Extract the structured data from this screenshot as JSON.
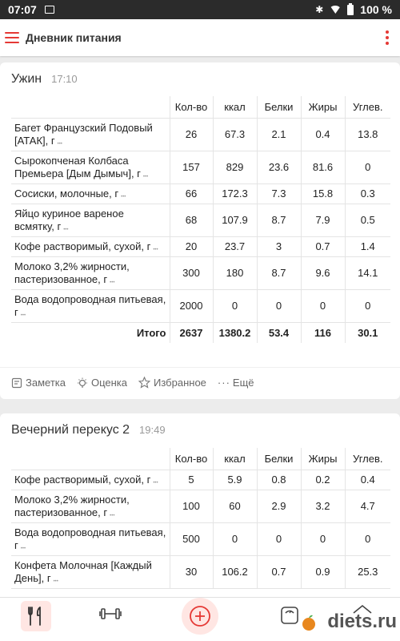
{
  "status": {
    "time": "07:07",
    "battery": "100 %"
  },
  "appbar": {
    "title": "Дневник питания"
  },
  "columns": [
    "Кол-во",
    "ккал",
    "Белки",
    "Жиры",
    "Углев."
  ],
  "meal1": {
    "name": "Ужин",
    "time": "17:10",
    "rows": [
      {
        "name": "Багет Французский Подовый [АТАК], г",
        "qty": "26",
        "kcal": "67.3",
        "protein": "2.1",
        "fat": "0.4",
        "carbs": "13.8"
      },
      {
        "name": "Сырокопченая Колбаса Премьера [Дым Дымыч], г",
        "qty": "157",
        "kcal": "829",
        "protein": "23.6",
        "fat": "81.6",
        "carbs": "0"
      },
      {
        "name": "Сосиски, молочные, г",
        "qty": "66",
        "kcal": "172.3",
        "protein": "7.3",
        "fat": "15.8",
        "carbs": "0.3"
      },
      {
        "name": "Яйцо куриное вареное всмятку, г",
        "qty": "68",
        "kcal": "107.9",
        "protein": "8.7",
        "fat": "7.9",
        "carbs": "0.5"
      },
      {
        "name": "Кофе растворимый, сухой, г",
        "qty": "20",
        "kcal": "23.7",
        "protein": "3",
        "fat": "0.7",
        "carbs": "1.4"
      },
      {
        "name": "Молоко 3,2% жирности, пастеризованное, г",
        "qty": "300",
        "kcal": "180",
        "protein": "8.7",
        "fat": "9.6",
        "carbs": "14.1"
      },
      {
        "name": "Вода водопроводная питьевая, г",
        "qty": "2000",
        "kcal": "0",
        "protein": "0",
        "fat": "0",
        "carbs": "0"
      }
    ],
    "total": {
      "label": "Итого",
      "qty": "2637",
      "kcal": "1380.2",
      "protein": "53.4",
      "fat": "116",
      "carbs": "30.1"
    },
    "actions": {
      "note": "Заметка",
      "rating": "Оценка",
      "favorite": "Избранное",
      "more": "Ещё"
    }
  },
  "meal2": {
    "name": "Вечерний перекус 2",
    "time": "19:49",
    "rows": [
      {
        "name": "Кофе растворимый, сухой, г",
        "qty": "5",
        "kcal": "5.9",
        "protein": "0.8",
        "fat": "0.2",
        "carbs": "0.4"
      },
      {
        "name": "Молоко 3,2% жирности, пастеризованное, г",
        "qty": "100",
        "kcal": "60",
        "protein": "2.9",
        "fat": "3.2",
        "carbs": "4.7"
      },
      {
        "name": "Вода водопроводная питьевая, г",
        "qty": "500",
        "kcal": "0",
        "protein": "0",
        "fat": "0",
        "carbs": "0"
      },
      {
        "name": "Конфета Молочная [Каждый День], г",
        "qty": "30",
        "kcal": "106.2",
        "protein": "0.7",
        "fat": "0.9",
        "carbs": "25.3"
      }
    ]
  },
  "watermark": "diets.ru",
  "colors": {
    "accent": "#e53935"
  }
}
